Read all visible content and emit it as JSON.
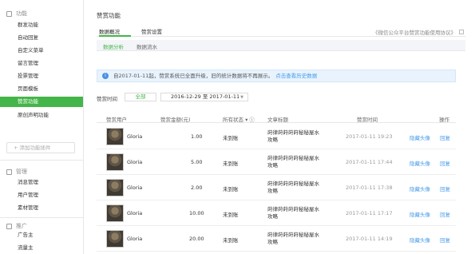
{
  "sidebar": {
    "groups": [
      {
        "title": "功能",
        "items": [
          "群发功能",
          "自动回复",
          "自定义菜单",
          "留言管理",
          "投票管理",
          "页面模板",
          "赞赏功能",
          "原创声明功能"
        ]
      },
      {
        "title": "管理",
        "items": [
          "消息管理",
          "用户管理",
          "素材管理"
        ]
      },
      {
        "title": "推广",
        "items": [
          "广告主",
          "流量主"
        ]
      }
    ],
    "active_item": "赞赏功能",
    "add_plugin_label": "+ 添加功能插件"
  },
  "main": {
    "title": "赞赏功能",
    "tabs": [
      "数据概况",
      "赞赏设置"
    ],
    "agreement": "《微信公众平台赞赏功能使用协议》",
    "subtabs": [
      "数据分析",
      "数据流水"
    ],
    "notice": {
      "text": "自2017-01-11起，赞赏系统已全面升级，旧的统计数据将不再展示。",
      "link": "点击查看历史数据"
    },
    "filter": {
      "label": "赞赏时间",
      "all": "全部",
      "range": "2016-12-29 至 2017-01-11"
    },
    "table": {
      "headers": [
        "赞赏用户",
        "赞赏金额(元)",
        "所有状态",
        "文章标题",
        "赞赏时间",
        "操作"
      ],
      "rows": [
        {
          "user": "Gloria",
          "amount": "1.00",
          "status": "未到账",
          "article": "莳律莳莳莳莳秘秘屋水\n攻略",
          "time": "2017-01-11 19:23",
          "hide": "隐藏头像",
          "reply": "回复"
        },
        {
          "user": "Gloria",
          "amount": "5.00",
          "status": "未到账",
          "article": "莳律莳莳莳莳秘秘屋水\n攻略",
          "time": "2017-01-11 17:44",
          "hide": "隐藏头像",
          "reply": "回复"
        },
        {
          "user": "Gloria",
          "amount": "2.00",
          "status": "未到账",
          "article": "莳律莳莳莳莳秘秘屋水\n攻略",
          "time": "2017-01-11 17:38",
          "hide": "隐藏头像",
          "reply": "回复"
        },
        {
          "user": "Gloria",
          "amount": "10.00",
          "status": "未到账",
          "article": "莳律莳莳莳莳秘秘屋水\n攻略",
          "time": "2017-01-11 17:17",
          "hide": "隐藏头像",
          "reply": "回复"
        },
        {
          "user": "Gloria",
          "amount": "20.00",
          "status": "未到账",
          "article": "莳律莳莳莳莳秘秘屋水\n攻略",
          "time": "2017-01-11 14:19",
          "hide": "隐藏头像",
          "reply": "回复"
        }
      ]
    }
  },
  "colors": {
    "accent": "#44b549",
    "link": "#459ae9",
    "notice_bg": "#e9f3fd"
  }
}
